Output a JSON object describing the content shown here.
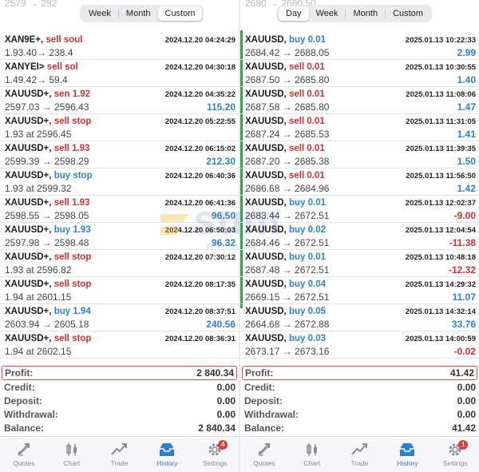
{
  "left": {
    "segments": [
      {
        "label": "Week",
        "active": false
      },
      {
        "label": "Month",
        "active": false
      },
      {
        "label": "Custom",
        "active": true
      }
    ],
    "rows": [
      {
        "symbol": "XAN9E+,",
        "side": "sell soul",
        "type": "sell",
        "time": "2024.12.20 04:24:29",
        "line2": "1.93.40→ 238.4",
        "pl": ""
      },
      {
        "symbol": "XANYEI>",
        "side": "sell sol",
        "type": "sell",
        "time": "2024.12.20 04:30:18",
        "line2": "1.49.42→ 59.4",
        "pl": ""
      },
      {
        "symbol": "XAUUSD+,",
        "side": "sen 1.92",
        "type": "sell",
        "time": "2024.12.20 04:35:22",
        "line2": "2597.03 → 2596.43",
        "pl": "115.20"
      },
      {
        "symbol": "XAUUSD+,",
        "side": "sell stop",
        "type": "sell",
        "time": "2024.12.20 05:22:55",
        "line2": "1.93 at 2596.45",
        "pl": ""
      },
      {
        "symbol": "XAUUSD+,",
        "side": "sell 1.93",
        "type": "sell",
        "time": "2024.12.20 06:15:02",
        "line2": "2599.39 → 2598.29",
        "pl": "212.30"
      },
      {
        "symbol": "XAUUSD+,",
        "side": "buy stop",
        "type": "buy",
        "time": "2024.12.20 06:40:36",
        "line2": "1.93 at 2599.32",
        "pl": ""
      },
      {
        "symbol": "XAUUSD+,",
        "side": "sell 1.93",
        "type": "sell",
        "time": "2024.12.20 06:41:36",
        "line2": "2598.55 → 2598.05",
        "pl": "96.50"
      },
      {
        "symbol": "XAUUSD+,",
        "side": "buy 1.93",
        "type": "buy",
        "time": "2024.12.20 06:50:03",
        "line2": "2597.98 → 2598.48",
        "pl": "96.32"
      },
      {
        "symbol": "XAUUSD+,",
        "side": "sell stop",
        "type": "sell",
        "time": "2024.12.20 07:30:12",
        "line2": "1.93 at 2596.82",
        "pl": ""
      },
      {
        "symbol": "XAUUSD+,",
        "side": "sell stop",
        "type": "sell",
        "time": "2024.12.20 08:17:35",
        "line2": "1.94 at 2601.15",
        "pl": ""
      },
      {
        "symbol": "XAUUSD+,",
        "side": "buy 1.94",
        "type": "buy",
        "time": "2024.12.20 08:37:51",
        "line2": "2603.94 → 2605.18",
        "pl": "240.56"
      },
      {
        "symbol": "XAUUSD+,",
        "side": "sell stop",
        "type": "sell",
        "time": "2024.12.20 08:36:31",
        "line2": "1.94 at 2602.15",
        "pl": ""
      }
    ],
    "summary": {
      "profit_label": "Profit:",
      "profit": "2 840.34",
      "credit_label": "Credit:",
      "credit": "0.00",
      "deposit_label": "Deposit:",
      "deposit": "0.00",
      "withdrawal_label": "Withdrawal:",
      "withdrawal": "0.00",
      "balance_label": "Balance:",
      "balance": "2 840.34"
    },
    "tabs": [
      {
        "label": "Quotes",
        "icon": "quotes-icon"
      },
      {
        "label": "Chart",
        "icon": "chart-icon"
      },
      {
        "label": "Trade",
        "icon": "trade-icon"
      },
      {
        "label": "History",
        "icon": "history-icon",
        "active": true
      },
      {
        "label": "Settings",
        "icon": "settings-icon",
        "badge": "4"
      }
    ]
  },
  "right": {
    "segments": [
      {
        "label": "Day",
        "active": true
      },
      {
        "label": "Week",
        "active": false
      },
      {
        "label": "Month",
        "active": false
      },
      {
        "label": "Custom",
        "active": false
      }
    ],
    "rows": [
      {
        "symbol": "XAUUSD,",
        "side": "buy 0.01",
        "type": "buy",
        "time": "2025.01.13 10:22:33",
        "line2": "2684.42 → 2688.05",
        "pl": "2.99"
      },
      {
        "symbol": "XAUUSD,",
        "side": "sell 0.01",
        "type": "sell",
        "time": "2025.01.13 10:30:55",
        "line2": "2687.50 → 2685.80",
        "pl": "1.40"
      },
      {
        "symbol": "XAUUSD,",
        "side": "sell 0.01",
        "type": "sell",
        "time": "2025.01.13 11:08:06",
        "line2": "2687.58 → 2685.80",
        "pl": "1.47"
      },
      {
        "symbol": "XAUUSD,",
        "side": "sell 0.01",
        "type": "sell",
        "time": "2025.01.13 11:31:05",
        "line2": "2687.24 → 2685.53",
        "pl": "1.41"
      },
      {
        "symbol": "XAUUSD,",
        "side": "sell 0.01",
        "type": "sell",
        "time": "2025.01.13 11:39:35",
        "line2": "2687.20 → 2685.38",
        "pl": "1.50"
      },
      {
        "symbol": "XAUUSD,",
        "side": "sell 0.01",
        "type": "sell",
        "time": "2025.01.13 11:56:50",
        "line2": "2686.68 → 2684.96",
        "pl": "1.42"
      },
      {
        "symbol": "XAUUSD,",
        "side": "buy 0.01",
        "type": "buy",
        "time": "2025.01.13 12:02:37",
        "line2": "2683.44 → 2672.51",
        "pl": "-9.00"
      },
      {
        "symbol": "XAUUSD,",
        "side": "buy 0.02",
        "type": "buy",
        "time": "2025.01.13 12:04:54",
        "line2": "2684.46 → 2672.51",
        "pl": "-11.38"
      },
      {
        "symbol": "XAUUSD,",
        "side": "buy 0.01",
        "type": "buy",
        "time": "2025.01.13 10:48:18",
        "line2": "2687.48 → 2672.51",
        "pl": "-12.32"
      },
      {
        "symbol": "XAUUSD,",
        "side": "buy 0.04",
        "type": "buy",
        "time": "2025.01.13 14:29:32",
        "line2": "2669.15 → 2672.51",
        "pl": "11.07"
      },
      {
        "symbol": "XAUUSD,",
        "side": "buy 0.05",
        "type": "buy",
        "time": "2025.01.13 14:32:14",
        "line2": "2664.68 → 2672.88",
        "pl": "33.76"
      },
      {
        "symbol": "XAUUSD,",
        "side": "buy 0.03",
        "type": "buy",
        "time": "2025.01.13 14:00:59",
        "line2": "2673.17 → 2673.16",
        "pl": "-0.02"
      }
    ],
    "summary": {
      "profit_label": "Profit:",
      "profit": "41.42",
      "credit_label": "Credit:",
      "credit": "0.00",
      "deposit_label": "Deposit:",
      "deposit": "0.00",
      "withdrawal_label": "Withdrawal:",
      "withdrawal": "0.00",
      "balance_label": "Balance:",
      "balance": "41.42"
    },
    "tabs": [
      {
        "label": "Quotes",
        "icon": "quotes-icon"
      },
      {
        "label": "Chart",
        "icon": "chart-icon"
      },
      {
        "label": "Trade",
        "icon": "trade-icon"
      },
      {
        "label": "History",
        "icon": "history-icon",
        "active": true
      },
      {
        "label": "Settings",
        "icon": "settings-icon",
        "badge": "1"
      }
    ]
  },
  "watermark": {
    "word": "sum",
    "sub": "mtrade fx"
  },
  "colors": {
    "sell": "#d0312d",
    "buy": "#2d7fd6",
    "profit_border": "#e04848",
    "active_tab": "#2d7fd6",
    "green_bar": "#2aa84a"
  }
}
